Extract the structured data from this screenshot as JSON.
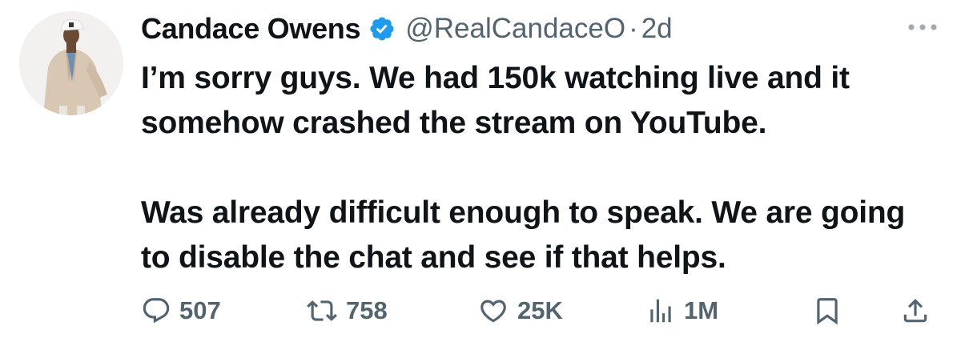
{
  "author": {
    "display_name": "Candace Owens",
    "handle": "@RealCandaceO",
    "separator": "·",
    "time_ago": "2d",
    "verified": true
  },
  "tweet": {
    "paragraphs": [
      "I’m sorry guys. We had 150k watching live and it somehow crashed the stream on YouTube.",
      "Was already difficult enough to speak. We are going to disable the chat and see if that helps."
    ]
  },
  "actions": {
    "replies": "507",
    "retweets": "758",
    "likes": "25K",
    "views": "1M"
  },
  "icons": {
    "more": "more-horizontal-icon",
    "verified": "verified-badge-icon",
    "reply": "reply-icon",
    "retweet": "retweet-icon",
    "like": "heart-icon",
    "views": "analytics-icon",
    "bookmark": "bookmark-icon",
    "share": "share-icon"
  },
  "colors": {
    "text_primary": "#0f1419",
    "text_secondary": "#536471",
    "verified_blue": "#1d9bf0"
  }
}
